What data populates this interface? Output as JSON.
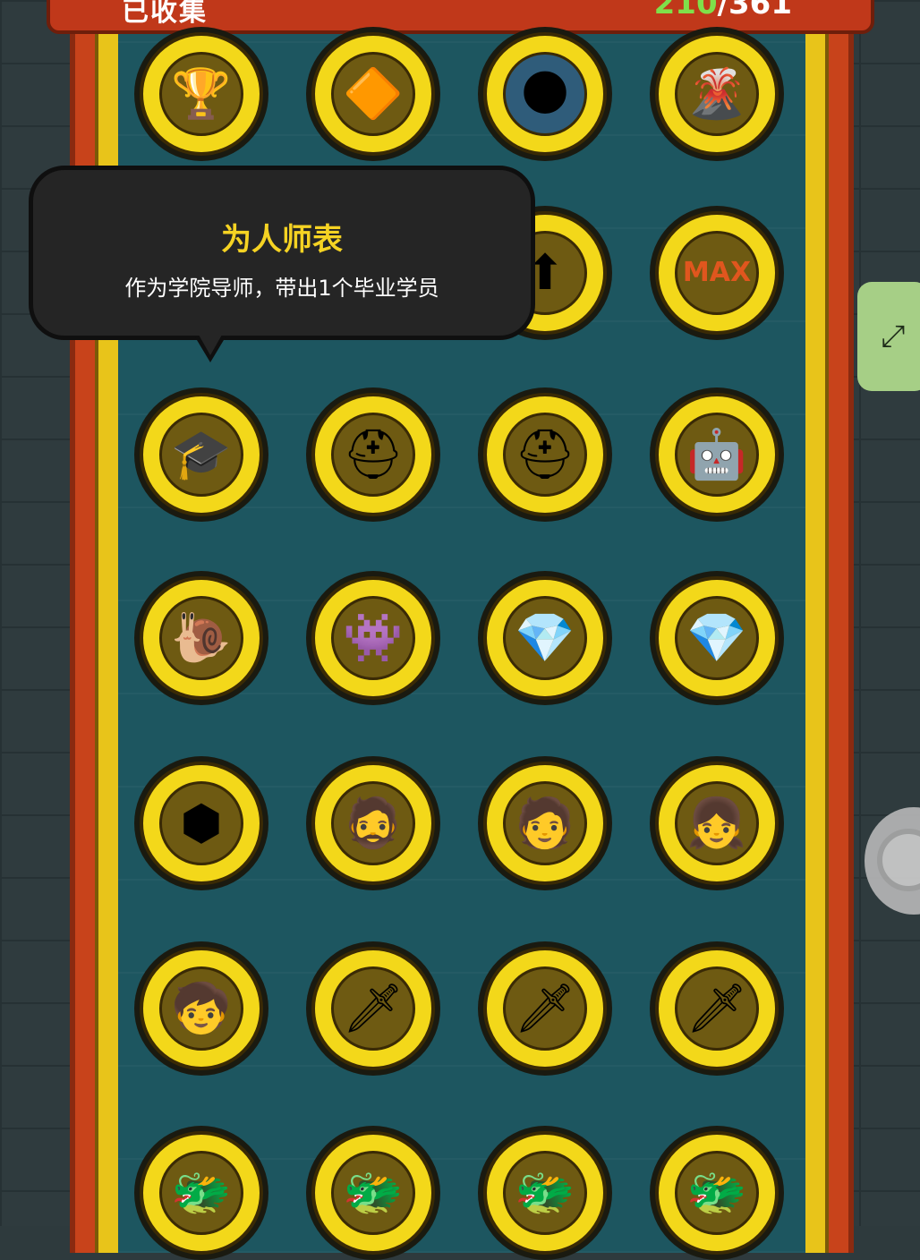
{
  "header": {
    "title": "已收集",
    "count_current": "210",
    "count_sep_total": "/361"
  },
  "tooltip": {
    "title": "为人师表",
    "description": "作为学院导师，带出1个毕业学员"
  },
  "badges": [
    {
      "name": "golden-trophy-badge",
      "glyph": "🏆",
      "color": "#6e5a12"
    },
    {
      "name": "red-crystal-badge",
      "glyph": "🔶",
      "color": "#6e5a12"
    },
    {
      "name": "blue-crater-badge",
      "glyph": "🌑",
      "color": "#2f5c7a"
    },
    {
      "name": "volcano-badge",
      "glyph": "🌋",
      "color": "#6e5a12"
    },
    {
      "name": "hidden-badge-1",
      "glyph": "",
      "color": "#6e5a12"
    },
    {
      "name": "hidden-badge-2",
      "glyph": "",
      "color": "#6e5a12"
    },
    {
      "name": "green-arrow-up-badge",
      "glyph": "⬆",
      "color": "#6e5a12"
    },
    {
      "name": "max-level-badge",
      "glyph": "MAX",
      "color": "#6e5a12"
    },
    {
      "name": "graduate-mentor-badge",
      "glyph": "🎓",
      "color": "#6e5a12"
    },
    {
      "name": "silver-helmet-badge",
      "glyph": "⛑",
      "color": "#6e5a12"
    },
    {
      "name": "gold-helmet-badge",
      "glyph": "⛑",
      "color": "#6e5a12"
    },
    {
      "name": "robot-skull-badge",
      "glyph": "🤖",
      "color": "#6e5a12"
    },
    {
      "name": "pink-snail-badge",
      "glyph": "🐌",
      "color": "#6e5a12"
    },
    {
      "name": "purple-monster-badge",
      "glyph": "👾",
      "color": "#6e5a12"
    },
    {
      "name": "gem-set-blue-badge",
      "glyph": "💎",
      "color": "#6e5a12"
    },
    {
      "name": "gem-set-yellow-badge",
      "glyph": "💎",
      "color": "#6e5a12"
    },
    {
      "name": "gem-set-bronze-badge",
      "glyph": "⬢",
      "color": "#6e5a12"
    },
    {
      "name": "shaggy-hero-badge",
      "glyph": "🧔",
      "color": "#6e5a12"
    },
    {
      "name": "blue-hair-goggles-badge",
      "glyph": "🧑",
      "color": "#6e5a12"
    },
    {
      "name": "red-hair-girl-badge",
      "glyph": "👧",
      "color": "#6e5a12"
    },
    {
      "name": "brown-hair-kid-badge",
      "glyph": "🧒",
      "color": "#6e5a12"
    },
    {
      "name": "bronze-warrior-badge",
      "glyph": "🗡",
      "color": "#6e5a12"
    },
    {
      "name": "orange-warrior-badge",
      "glyph": "🗡",
      "color": "#6e5a12"
    },
    {
      "name": "silver-warrior-badge",
      "glyph": "🗡",
      "color": "#6e5a12"
    },
    {
      "name": "gold-beast-badge",
      "glyph": "🐲",
      "color": "#6e5a12"
    },
    {
      "name": "bronze-beast-badge",
      "glyph": "🐲",
      "color": "#6e5a12"
    },
    {
      "name": "orange-beast-badge",
      "glyph": "🐲",
      "color": "#6e5a12"
    },
    {
      "name": "silver-beast-badge",
      "glyph": "🐲",
      "color": "#6e5a12"
    }
  ],
  "side": {
    "expand_icon": "⤢"
  }
}
